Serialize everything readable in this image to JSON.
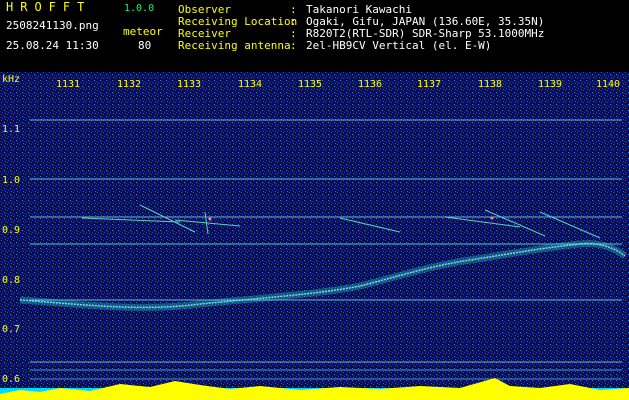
{
  "header": {
    "app_title": "HROFFT",
    "app_version": "1.0.0",
    "file_name": "2508241130.png",
    "meteor_label": "meteor",
    "timestamp": "25.08.24 11:30",
    "meteor_count": "80"
  },
  "info": [
    {
      "label": "Observer",
      "value": "Takanori Kawachi"
    },
    {
      "label": "Receiving Location",
      "value": "Ogaki, Gifu, JAPAN (136.60E, 35.35N)"
    },
    {
      "label": "Receiver",
      "value": "R820T2(RTL-SDR) SDR-Sharp 53.1000MHz"
    },
    {
      "label": "Receiving antenna",
      "value": "2el-HB9CV Vertical (el. E-W)"
    }
  ],
  "axis": {
    "y_unit": "kHz",
    "y_ticks": [
      "1.1",
      "1.0",
      "0.9",
      "0.8",
      "0.7",
      "0.6"
    ],
    "x_ticks": [
      "1131",
      "1132",
      "1133",
      "1134",
      "1135",
      "1136",
      "1137",
      "1138",
      "1139",
      "1140"
    ]
  },
  "colors": {
    "label": "#ffff00",
    "value": "#00ff66",
    "background": "#000000",
    "plot_bg": "#0a0e4a",
    "line": "#7fdcff"
  }
}
